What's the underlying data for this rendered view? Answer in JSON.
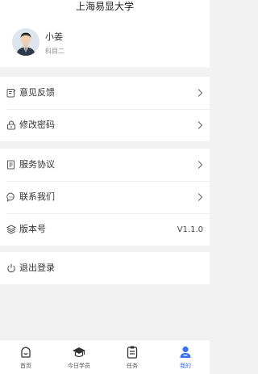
{
  "header": {
    "title": "上海易显大学"
  },
  "profile": {
    "name": "小姜",
    "subtitle": "科目二"
  },
  "menu": {
    "feedback": "意见反馈",
    "change_password": "修改密码",
    "service_agreement": "服务协议",
    "contact_us": "联系我们",
    "version_label": "版本号",
    "version_value": "V1.1.0",
    "logout": "退出登录"
  },
  "tabbar": {
    "items": [
      {
        "label": "首页",
        "icon": "home-icon"
      },
      {
        "label": "今日学员",
        "icon": "graduation-cap-icon"
      },
      {
        "label": "任务",
        "icon": "clipboard-icon"
      },
      {
        "label": "我的",
        "icon": "user-icon"
      }
    ],
    "active_index": 3
  },
  "colors": {
    "accent": "#3b6ff5",
    "background": "#f2f2f2"
  }
}
